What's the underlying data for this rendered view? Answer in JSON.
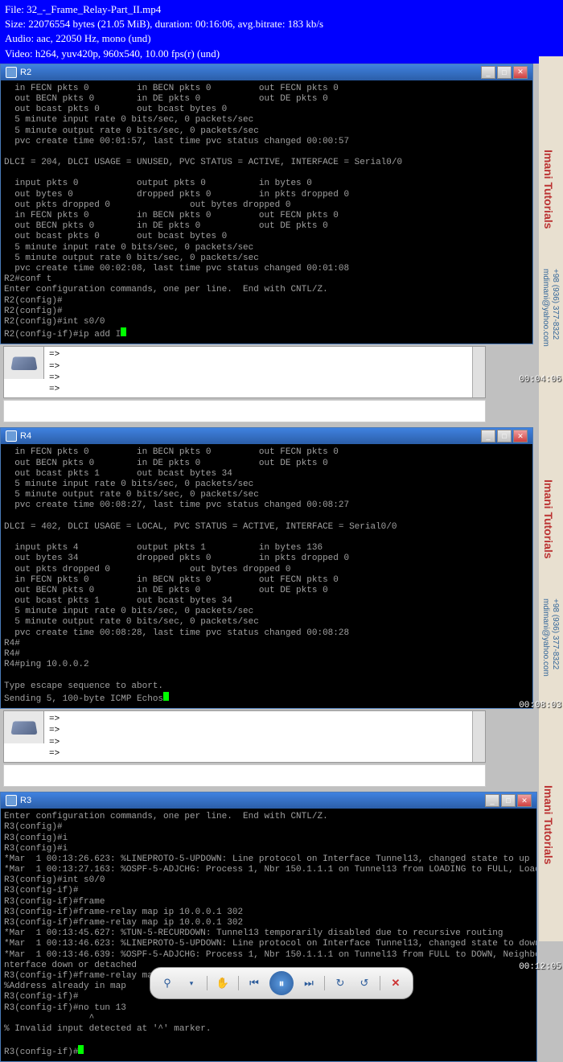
{
  "header": {
    "line1": "File: 32_-_Frame_Relay-Part_II.mp4",
    "line2": "Size: 22076554 bytes (21.05 MiB), duration: 00:16:06, avg.bitrate: 183 kb/s",
    "line3": "Audio: aac, 22050 Hz, mono (und)",
    "line4": "Video: h264, yuv420p, 960x540, 10.00 fps(r) (und)"
  },
  "windows": {
    "r2": {
      "title": "R2",
      "timestamp": "00:04:06",
      "terminal": "  in FECN pkts 0         in BECN pkts 0         out FECN pkts 0\n  out BECN pkts 0        in DE pkts 0           out DE pkts 0\n  out bcast pkts 0       out bcast bytes 0\n  5 minute input rate 0 bits/sec, 0 packets/sec\n  5 minute output rate 0 bits/sec, 0 packets/sec\n  pvc create time 00:01:57, last time pvc status changed 00:00:57\n\nDLCI = 204, DLCI USAGE = UNUSED, PVC STATUS = ACTIVE, INTERFACE = Serial0/0\n\n  input pkts 0           output pkts 0          in bytes 0\n  out bytes 0            dropped pkts 0         in pkts dropped 0\n  out pkts dropped 0               out bytes dropped 0\n  in FECN pkts 0         in BECN pkts 0         out FECN pkts 0\n  out BECN pkts 0        in DE pkts 0           out DE pkts 0\n  out bcast pkts 0       out bcast bytes 0\n  5 minute input rate 0 bits/sec, 0 packets/sec\n  5 minute output rate 0 bits/sec, 0 packets/sec\n  pvc create time 00:02:08, last time pvc status changed 00:01:08\nR2#conf t\nEnter configuration commands, one per line.  End with CNTL/Z.\nR2(config)#\nR2(config)#\nR2(config)#int s0/0\nR2(config-if)#ip add "
    },
    "r4": {
      "title": "R4",
      "timestamp": "00:08:03",
      "terminal": "  in FECN pkts 0         in BECN pkts 0         out FECN pkts 0\n  out BECN pkts 0        in DE pkts 0           out DE pkts 0\n  out bcast pkts 1       out bcast bytes 34\n  5 minute input rate 0 bits/sec, 0 packets/sec\n  5 minute output rate 0 bits/sec, 0 packets/sec\n  pvc create time 00:08:27, last time pvc status changed 00:08:27\n\nDLCI = 402, DLCI USAGE = LOCAL, PVC STATUS = ACTIVE, INTERFACE = Serial0/0\n\n  input pkts 4           output pkts 1          in bytes 136\n  out bytes 34           dropped pkts 0         in pkts dropped 0\n  out pkts dropped 0               out bytes dropped 0\n  in FECN pkts 0         in BECN pkts 0         out FECN pkts 0\n  out BECN pkts 0        in DE pkts 0           out DE pkts 0\n  out bcast pkts 1       out bcast bytes 34\n  5 minute input rate 0 bits/sec, 0 packets/sec\n  5 minute output rate 0 bits/sec, 0 packets/sec\n  pvc create time 00:08:28, last time pvc status changed 00:08:28\nR4#\nR4#\nR4#ping 10.0.0.2\n\nType escape sequence to abort.\nSending 5, 100-byte ICMP Echos"
    },
    "r3": {
      "title": "R3",
      "timestamp": "00:12:05",
      "terminal": "Enter configuration commands, one per line.  End with CNTL/Z.\nR3(config)#\nR3(config)#i\nR3(config)#i\n*Mar  1 00:13:26.623: %LINEPROTO-5-UPDOWN: Line protocol on Interface Tunnel13, changed state to up\n*Mar  1 00:13:27.163: %OSPF-5-ADJCHG: Process 1, Nbr 150.1.1.1 on Tunnel13 from LOADING to FULL, Loading Done\nR3(config)#int s0/0\nR3(config-if)#\nR3(config-if)#frame\nR3(config-if)#frame-relay map ip 10.0.0.1 302\nR3(config-if)#frame-relay map ip 10.0.0.1 302\n*Mar  1 00:13:45.627: %TUN-5-RECURDOWN: Tunnel13 temporarily disabled due to recursive routing\n*Mar  1 00:13:46.623: %LINEPROTO-5-UPDOWN: Line protocol on Interface Tunnel13, changed state to down\n*Mar  1 00:13:46.639: %OSPF-5-ADJCHG: Process 1, Nbr 150.1.1.1 on Tunnel13 from FULL to DOWN, Neighbor Down: I\nnterface down or detached\nR3(config-if)#frame-relay map ip 10.0.0.4 302\n%Address already in map\nR3(config-if)#\nR3(config-if)#no tun 13\n                ^\n% Invalid input detected at '^' marker.\n\nR3(config-if)#"
    }
  },
  "subpanel": {
    "arrows": "=>\n=>\n=>\n=>"
  },
  "sidebar": {
    "brand": "Imani Tutorials",
    "contact1": "+98 (936) 377-8322",
    "contact2": "mdimani@yahoo.com"
  },
  "toolbar": {
    "zoom": "⚲",
    "dropdown": "▾",
    "hand": "✋",
    "prev": "⏮",
    "play": "⏸",
    "next": "⏭",
    "loop": "↻",
    "reload": "↺",
    "stop": "✕"
  },
  "winbtn": {
    "min": "_",
    "max": "□",
    "close": "✕"
  }
}
